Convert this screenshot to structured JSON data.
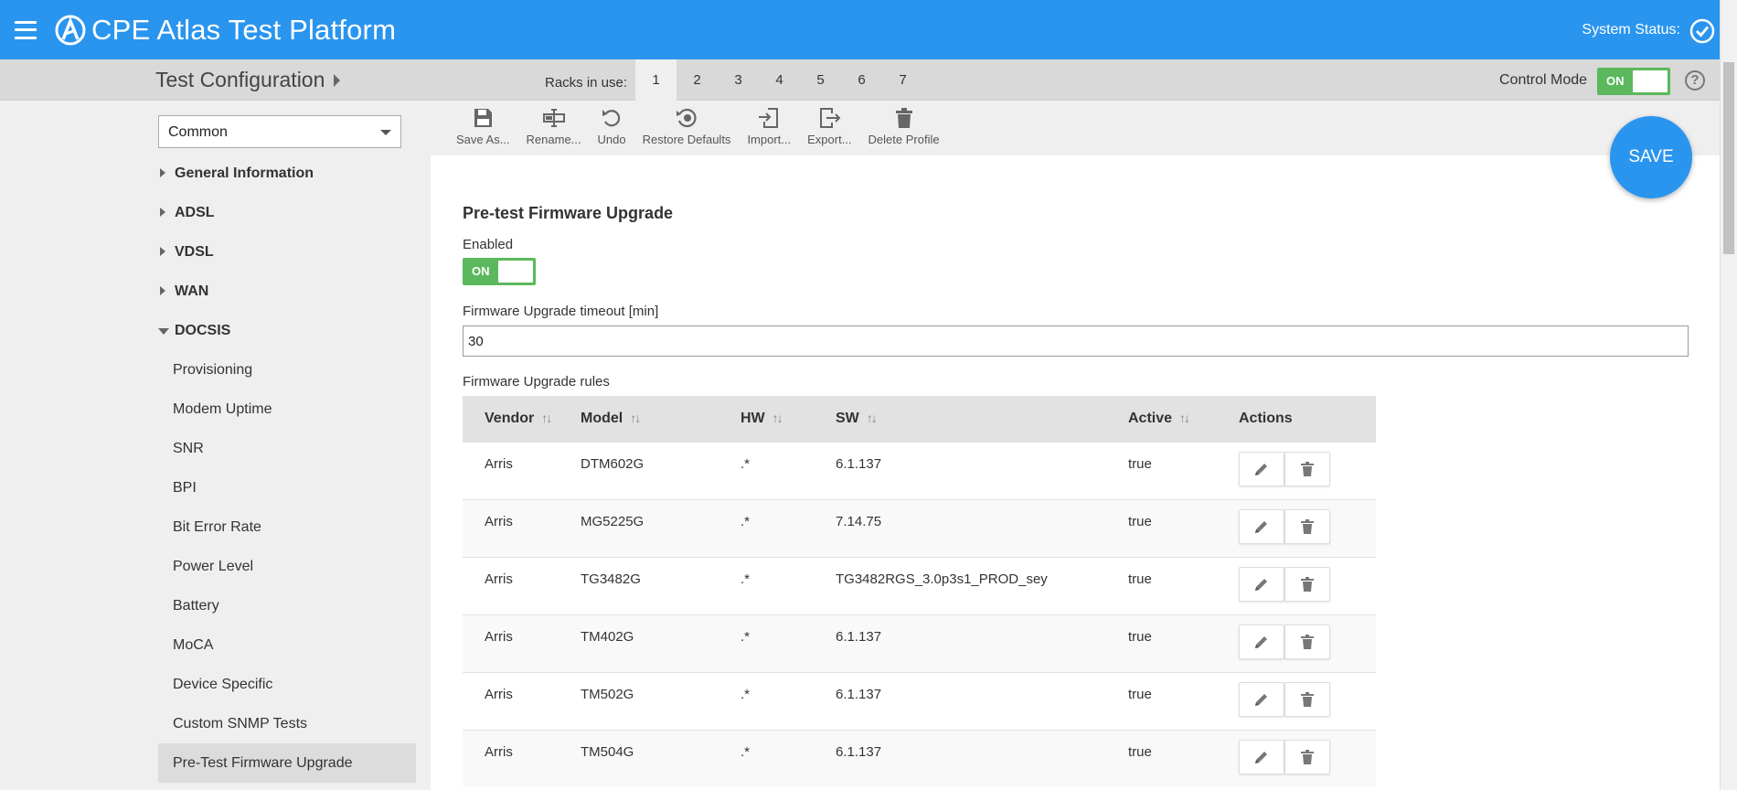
{
  "header": {
    "app_title": "CPE Atlas Test Platform",
    "system_status_label": "System Status:"
  },
  "subheader": {
    "page_title": "Test Configuration",
    "racks_label": "Racks in use:",
    "racks": [
      "1",
      "2",
      "3",
      "4",
      "5",
      "6",
      "7"
    ],
    "active_rack": "1",
    "control_mode_label": "Control Mode",
    "control_mode_value": "ON",
    "help_glyph": "?"
  },
  "sidebar": {
    "profile_select": "Common",
    "groups": [
      {
        "label": "General Information",
        "expanded": false
      },
      {
        "label": "ADSL",
        "expanded": false
      },
      {
        "label": "VDSL",
        "expanded": false
      },
      {
        "label": "WAN",
        "expanded": false
      },
      {
        "label": "DOCSIS",
        "expanded": true
      }
    ],
    "docsis_items": [
      "Provisioning",
      "Modem Uptime",
      "SNR",
      "BPI",
      "Bit Error Rate",
      "Power Level",
      "Battery",
      "MoCA",
      "Device Specific",
      "Custom SNMP Tests",
      "Pre-Test Firmware Upgrade"
    ],
    "selected_item": "Pre-Test Firmware Upgrade"
  },
  "toolbar": {
    "save_as": "Save As...",
    "rename": "Rename...",
    "undo": "Undo",
    "restore_defaults": "Restore Defaults",
    "import": "Import...",
    "export": "Export...",
    "delete_profile": "Delete Profile"
  },
  "save_button": "SAVE",
  "section": {
    "title": "Pre-test Firmware Upgrade",
    "enabled_label": "Enabled",
    "enabled_value": "ON",
    "timeout_label": "Firmware Upgrade timeout [min]",
    "timeout_value": "30",
    "rules_label": "Firmware Upgrade rules"
  },
  "rules_table": {
    "columns": [
      "Vendor",
      "Model",
      "HW",
      "SW",
      "Active",
      "Actions"
    ],
    "sort_glyph": "↑↓",
    "rows": [
      {
        "vendor": "Arris",
        "model": "DTM602G",
        "hw": ".*",
        "sw": "6.1.137",
        "active": "true"
      },
      {
        "vendor": "Arris",
        "model": "MG5225G",
        "hw": ".*",
        "sw": "7.14.75",
        "active": "true"
      },
      {
        "vendor": "Arris",
        "model": "TG3482G",
        "hw": ".*",
        "sw": "TG3482RGS_3.0p3s1_PROD_sey",
        "active": "true"
      },
      {
        "vendor": "Arris",
        "model": "TM402G",
        "hw": ".*",
        "sw": "6.1.137",
        "active": "true"
      },
      {
        "vendor": "Arris",
        "model": "TM502G",
        "hw": ".*",
        "sw": "6.1.137",
        "active": "true"
      },
      {
        "vendor": "Arris",
        "model": "TM504G",
        "hw": ".*",
        "sw": "6.1.137",
        "active": "true"
      }
    ]
  },
  "colors": {
    "header_blue": "#2a95ee",
    "toggle_green": "#5cb85c"
  },
  "icons": {
    "menu": "hamburger-icon",
    "logo": "atlas-logo",
    "status": "check-circle-icon",
    "help": "help-circle-icon",
    "save_as": "floppy-disk-icon",
    "rename": "rename-cursor-icon",
    "undo": "undo-arrow-icon",
    "restore": "restore-target-icon",
    "import": "import-icon",
    "export": "export-icon",
    "delete": "trash-icon",
    "edit": "pencil-icon"
  }
}
